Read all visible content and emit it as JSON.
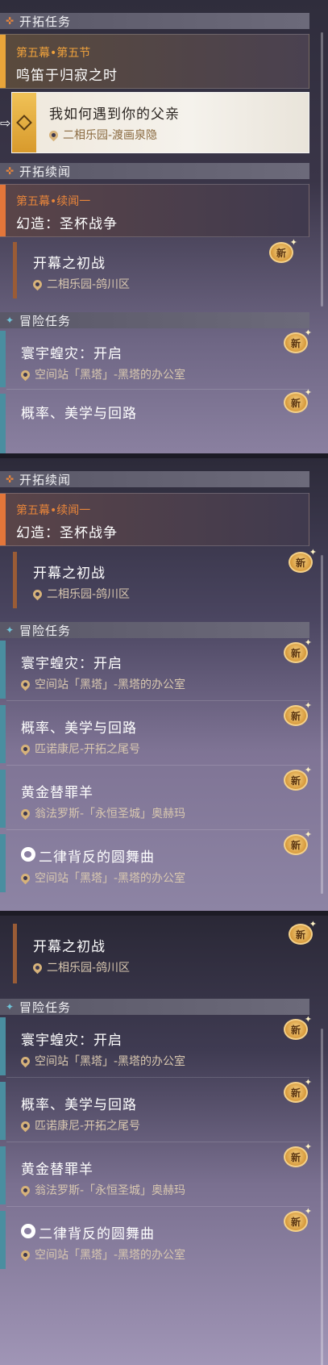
{
  "sections": {
    "trailblaze": "开拓任务",
    "companion": "开拓续闻",
    "adventure": "冒险任务"
  },
  "main_chapter": {
    "chapter": "第五幕•第五节",
    "title": "鸣笛于归寂之时"
  },
  "active_quest": {
    "name": "我如何遇到你的父亲",
    "location": "二相乐园-渡画泉隐"
  },
  "companion_chapter": {
    "chapter": "第五幕•续闻一",
    "title": "幻造：圣杯战争"
  },
  "companion_quest": {
    "name": "开幕之初战",
    "location": "二相乐园-鸽川区"
  },
  "adventure_quests": [
    {
      "name": "寰宇蝗灾：开启",
      "location": "空间站「黑塔」-黑塔的办公室"
    },
    {
      "name": "概率、美学与回路",
      "location": "匹诺康尼-开拓之尾号"
    },
    {
      "name": "黄金替罪羊",
      "location": "翁法罗斯-「永恒圣城」奥赫玛"
    },
    {
      "name": "二律背反的圆舞曲",
      "location": "空间站「黑塔」-黑塔的办公室"
    }
  ],
  "badge_label": "新",
  "colors": {
    "gold": "#e9a53a",
    "orange": "#e3763a",
    "teal": "#4a8ea0"
  }
}
